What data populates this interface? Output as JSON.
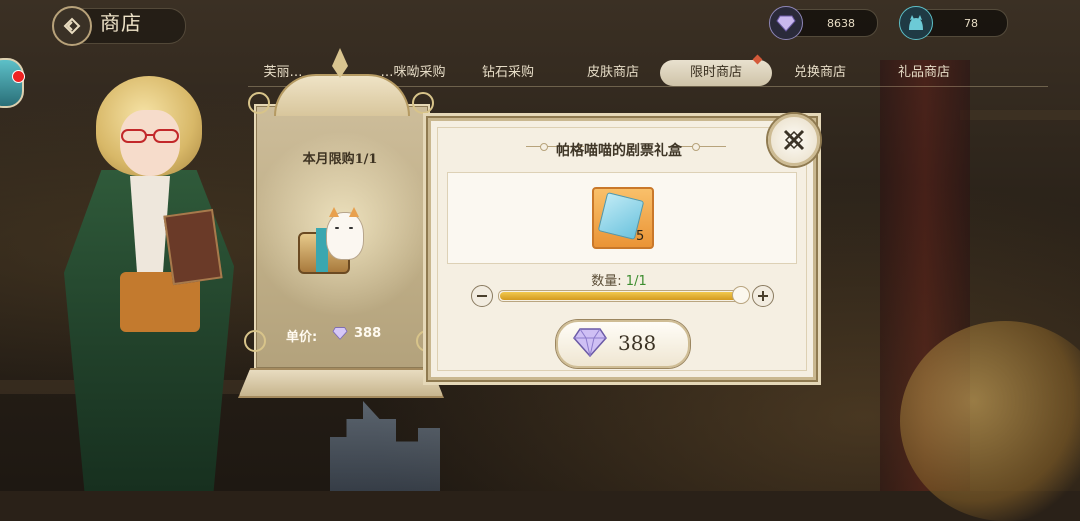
{
  "header": {
    "title": "商店",
    "back_icon": "back-icon"
  },
  "currencies": [
    {
      "icon": "gem-icon",
      "value": "8638",
      "color": "#8e86b8"
    },
    {
      "icon": "cat-token-icon",
      "value": "78",
      "color": "#5dc0c8"
    }
  ],
  "tabs": [
    {
      "label": "芙丽…",
      "active": false
    },
    {
      "label": "…咪呦采购",
      "active": false
    },
    {
      "label": "钻石采购",
      "active": false
    },
    {
      "label": "皮肤商店",
      "active": false
    },
    {
      "label": "限时商店",
      "active": true
    },
    {
      "label": "兑换商店",
      "active": false
    },
    {
      "label": "礼品商店",
      "active": false
    }
  ],
  "product_card": {
    "limit_text": "本月限购1/1",
    "price_label": "单价:",
    "price_value": "388"
  },
  "purchase_panel": {
    "title": "帕格喵喵的剧票礼盒",
    "item": {
      "icon": "ticket-icon",
      "count": "5"
    },
    "quantity_label": "数量: ",
    "quantity_value": "1/1",
    "quantity_fraction": 1.0,
    "buy_price": "388",
    "close_icon": "close-icon",
    "minus_icon": "minus-icon",
    "plus_icon": "plus-icon"
  },
  "colors": {
    "accent_gold": "#d39a20",
    "quantity_green": "#3c8d2f",
    "notification_red": "#e22222"
  }
}
